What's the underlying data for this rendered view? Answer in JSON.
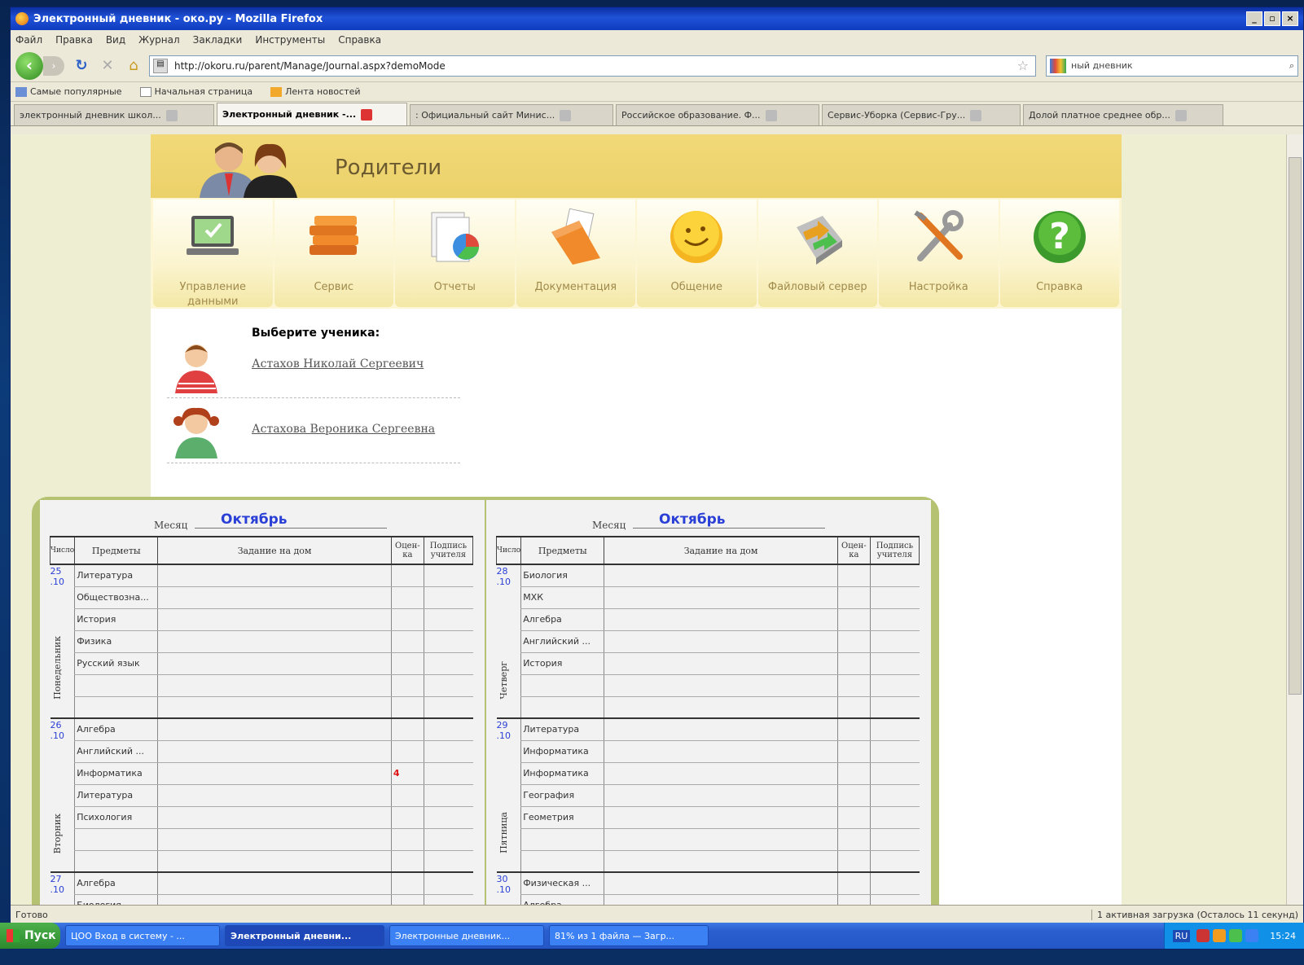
{
  "window": {
    "title": "Электронный дневник - око.ру - Mozilla Firefox",
    "controls": [
      "_",
      "▫",
      "×"
    ]
  },
  "menubar": [
    "Файл",
    "Правка",
    "Вид",
    "Журнал",
    "Закладки",
    "Инструменты",
    "Справка"
  ],
  "nav": {
    "url": "http://okoru.ru/parent/Manage/Journal.aspx?demoMode",
    "search_value": "ный дневник"
  },
  "bookmarks": [
    "Самые популярные",
    "Начальная страница",
    "Лента новостей"
  ],
  "tabs": [
    {
      "label": "электронный дневник школ...",
      "active": false
    },
    {
      "label": "Электронный дневник -...",
      "active": true
    },
    {
      "label": ": Официальный сайт Минис...",
      "active": false
    },
    {
      "label": "Российское образование. Ф...",
      "active": false
    },
    {
      "label": "Сервис-Уборка (Сервис-Гру...",
      "active": false
    },
    {
      "label": "Долой платное среднее обр...",
      "active": false
    }
  ],
  "header": {
    "title": "Родители"
  },
  "modules": [
    {
      "label": "Управление данными",
      "icon": "laptop-icon"
    },
    {
      "label": "Сервис",
      "icon": "books-icon"
    },
    {
      "label": "Отчеты",
      "icon": "report-chart-icon"
    },
    {
      "label": "Документация",
      "icon": "folder-documents-icon"
    },
    {
      "label": "Общение",
      "icon": "smiley-icon"
    },
    {
      "label": "Файловый сервер",
      "icon": "file-server-icon"
    },
    {
      "label": "Настройка",
      "icon": "tools-icon"
    },
    {
      "label": "Справка",
      "icon": "help-icon"
    }
  ],
  "students": {
    "heading": "Выберите ученика:",
    "list": [
      {
        "name": "Астахов Николай Сергеевич"
      },
      {
        "name": "Астахова Вероника Сергеевна"
      }
    ]
  },
  "journal": {
    "headers": {
      "day": "Число",
      "subject": "Предметы",
      "homework": "Задание на дом",
      "grade": "Оцен-ка",
      "signature": "Подпись учителя"
    },
    "left": {
      "month_label": "Месяц",
      "month": "Октябрь",
      "days": [
        {
          "date": "25",
          "month": ".10",
          "name": "Понедельник",
          "rows": [
            {
              "subject": "Литература",
              "grade": ""
            },
            {
              "subject": "Обществозна...",
              "grade": ""
            },
            {
              "subject": "История",
              "grade": ""
            },
            {
              "subject": "Физика",
              "grade": ""
            },
            {
              "subject": "Русский язык",
              "grade": ""
            },
            {
              "subject": "",
              "grade": ""
            },
            {
              "subject": "",
              "grade": ""
            }
          ]
        },
        {
          "date": "26",
          "month": ".10",
          "name": "Вторник",
          "rows": [
            {
              "subject": "Алгебра",
              "grade": ""
            },
            {
              "subject": "Английский ...",
              "grade": ""
            },
            {
              "subject": "Информатика",
              "grade": "4"
            },
            {
              "subject": "Литература",
              "grade": ""
            },
            {
              "subject": "Психология",
              "grade": ""
            },
            {
              "subject": "",
              "grade": ""
            },
            {
              "subject": "",
              "grade": ""
            }
          ]
        },
        {
          "date": "27",
          "month": ".10",
          "name": "",
          "rows": [
            {
              "subject": "Алгебра",
              "grade": ""
            },
            {
              "subject": "Биология",
              "grade": ""
            }
          ]
        }
      ]
    },
    "right": {
      "month_label": "Месяц",
      "month": "Октябрь",
      "days": [
        {
          "date": "28",
          "month": ".10",
          "name": "Четверг",
          "rows": [
            {
              "subject": "Биология",
              "grade": ""
            },
            {
              "subject": "МХК",
              "grade": ""
            },
            {
              "subject": "Алгебра",
              "grade": ""
            },
            {
              "subject": "Английский ...",
              "grade": ""
            },
            {
              "subject": "История",
              "grade": ""
            },
            {
              "subject": "",
              "grade": ""
            },
            {
              "subject": "",
              "grade": ""
            }
          ]
        },
        {
          "date": "29",
          "month": ".10",
          "name": "Пятница",
          "rows": [
            {
              "subject": "Литература",
              "grade": ""
            },
            {
              "subject": "Информатика",
              "grade": ""
            },
            {
              "subject": "Информатика",
              "grade": ""
            },
            {
              "subject": "География",
              "grade": ""
            },
            {
              "subject": "Геометрия",
              "grade": ""
            },
            {
              "subject": "",
              "grade": ""
            },
            {
              "subject": "",
              "grade": ""
            }
          ]
        },
        {
          "date": "30",
          "month": ".10",
          "name": "",
          "rows": [
            {
              "subject": "Физическая ...",
              "grade": ""
            },
            {
              "subject": "Алгебра",
              "grade": ""
            }
          ]
        }
      ]
    }
  },
  "status": {
    "left": "Готово",
    "right": "1 активная загрузка (Осталось 11 секунд)"
  },
  "taskbar": {
    "start": "Пуск",
    "items": [
      {
        "label": "ЦОО Вход в систему - ...",
        "active": false
      },
      {
        "label": "Электронный дневни...",
        "active": true
      },
      {
        "label": "Электронные дневник...",
        "active": false
      },
      {
        "label": "81% из 1 файла — Загр...",
        "active": false
      }
    ],
    "lang": "RU",
    "clock": "15:24"
  },
  "colors": {
    "header": "#ecd16a",
    "month": "#2a3fd6",
    "grade": "#d11111",
    "book_cover": "#b5c271"
  }
}
